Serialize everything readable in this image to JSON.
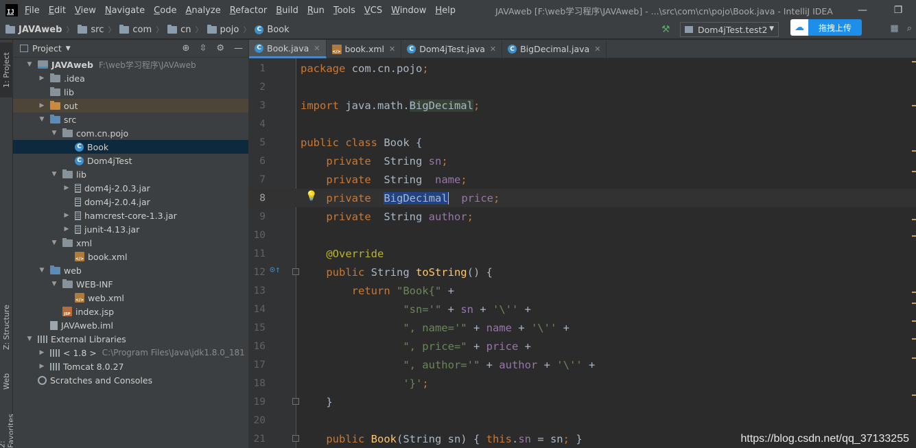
{
  "menubar": {
    "logo": "IJ",
    "items": [
      "File",
      "Edit",
      "View",
      "Navigate",
      "Code",
      "Analyze",
      "Refactor",
      "Build",
      "Run",
      "Tools",
      "VCS",
      "Window",
      "Help"
    ],
    "window_title": "JAVAweb [F:\\web学习程序\\JAVAweb] - ...\\src\\com\\cn\\pojo\\Book.java - IntelliJ IDEA",
    "minimize": "—",
    "restore": "❐"
  },
  "navbar": {
    "breadcrumbs": [
      "JAVAweb",
      "src",
      "com",
      "cn",
      "pojo",
      "Book"
    ],
    "run_config": "Dom4jTest.test2",
    "upload_label": "拖拽上传"
  },
  "left_stripe": {
    "project_tab": "1: Project",
    "structure_tab": "Z: Structure",
    "web_tab": "Web",
    "favorites_tab": "2: Favorites"
  },
  "project_panel": {
    "title": "Project",
    "tree": [
      {
        "label": "JAVAweb",
        "hint": "F:\\web学习程序\\JAVAweb",
        "depth": 0,
        "expanded": true,
        "icon": "module"
      },
      {
        "label": ".idea",
        "depth": 1,
        "expanded": false,
        "icon": "folder"
      },
      {
        "label": "lib",
        "depth": 1,
        "icon": "folder",
        "leaf": true
      },
      {
        "label": "out",
        "depth": 1,
        "expanded": false,
        "icon": "folder-out"
      },
      {
        "label": "src",
        "depth": 1,
        "expanded": true,
        "icon": "folder-src"
      },
      {
        "label": "com.cn.pojo",
        "depth": 2,
        "expanded": true,
        "icon": "folder"
      },
      {
        "label": "Book",
        "depth": 3,
        "icon": "class",
        "leaf": true,
        "selected": true
      },
      {
        "label": "Dom4jTest",
        "depth": 3,
        "icon": "class",
        "leaf": true
      },
      {
        "label": "lib",
        "depth": 2,
        "expanded": true,
        "icon": "folder"
      },
      {
        "label": "dom4j-2.0.3.jar",
        "depth": 3,
        "expanded": false,
        "icon": "jar"
      },
      {
        "label": "dom4j-2.0.4.jar",
        "depth": 3,
        "icon": "jar",
        "leaf": true
      },
      {
        "label": "hamcrest-core-1.3.jar",
        "depth": 3,
        "expanded": false,
        "icon": "jar"
      },
      {
        "label": "junit-4.13.jar",
        "depth": 3,
        "expanded": false,
        "icon": "jar"
      },
      {
        "label": "xml",
        "depth": 2,
        "expanded": true,
        "icon": "folder"
      },
      {
        "label": "book.xml",
        "depth": 3,
        "icon": "xml",
        "leaf": true
      },
      {
        "label": "web",
        "depth": 1,
        "expanded": true,
        "icon": "folder-web"
      },
      {
        "label": "WEB-INF",
        "depth": 2,
        "expanded": true,
        "icon": "folder"
      },
      {
        "label": "web.xml",
        "depth": 3,
        "icon": "xml",
        "leaf": true
      },
      {
        "label": "index.jsp",
        "depth": 2,
        "icon": "jsp",
        "leaf": true
      },
      {
        "label": "JAVAweb.iml",
        "depth": 1,
        "icon": "iml",
        "leaf": true
      },
      {
        "label": "External Libraries",
        "depth": 0,
        "expanded": true,
        "icon": "libs"
      },
      {
        "label": "< 1.8 >",
        "hint": "C:\\Program Files\\Java\\jdk1.8.0_181",
        "depth": 1,
        "expanded": false,
        "icon": "libs"
      },
      {
        "label": "Tomcat 8.0.27",
        "depth": 1,
        "expanded": false,
        "icon": "libs"
      },
      {
        "label": "Scratches and Consoles",
        "depth": 0,
        "icon": "scratch",
        "leaf": true
      }
    ]
  },
  "tabs": [
    {
      "label": "Book.java",
      "icon": "class",
      "active": true
    },
    {
      "label": "book.xml",
      "icon": "xml"
    },
    {
      "label": "Dom4jTest.java",
      "icon": "class"
    },
    {
      "label": "BigDecimal.java",
      "icon": "class"
    }
  ],
  "editor": {
    "current_line": 8,
    "lines": [
      [
        {
          "t": "package ",
          "c": "kw"
        },
        {
          "t": "com.cn.pojo"
        },
        {
          "t": ";",
          "c": "kw"
        }
      ],
      [],
      [
        {
          "t": "import ",
          "c": "kw"
        },
        {
          "t": "java.math."
        },
        {
          "t": "BigDecimal",
          "c": "imp"
        },
        {
          "t": ";",
          "c": "kw"
        }
      ],
      [],
      [
        {
          "t": "public class ",
          "c": "kw"
        },
        {
          "t": "Book {"
        }
      ],
      [
        {
          "t": "    private  ",
          "c": "kw"
        },
        {
          "t": "String "
        },
        {
          "t": "sn",
          "c": "fld"
        },
        {
          "t": ";",
          "c": "kw"
        }
      ],
      [
        {
          "t": "    private  ",
          "c": "kw"
        },
        {
          "t": "String  "
        },
        {
          "t": "name",
          "c": "fld"
        },
        {
          "t": ";",
          "c": "kw"
        }
      ],
      [
        {
          "t": "    private  ",
          "c": "kw"
        },
        {
          "t": "BigDecimal",
          "c": "sel"
        },
        {
          "t": "  "
        },
        {
          "t": "price",
          "c": "fld"
        },
        {
          "t": ";",
          "c": "kw"
        }
      ],
      [
        {
          "t": "    private  ",
          "c": "kw"
        },
        {
          "t": "String "
        },
        {
          "t": "author",
          "c": "fld"
        },
        {
          "t": ";",
          "c": "kw"
        }
      ],
      [],
      [
        {
          "t": "    @Override",
          "c": "ann"
        }
      ],
      [
        {
          "t": "    public ",
          "c": "kw"
        },
        {
          "t": "String "
        },
        {
          "t": "toString",
          "c": "fn"
        },
        {
          "t": "() {"
        }
      ],
      [
        {
          "t": "        return ",
          "c": "kw"
        },
        {
          "t": "\"Book{\"",
          "c": "str"
        },
        {
          "t": " +"
        }
      ],
      [
        {
          "t": "                "
        },
        {
          "t": "\"sn='\"",
          "c": "str"
        },
        {
          "t": " + "
        },
        {
          "t": "sn",
          "c": "fld"
        },
        {
          "t": " + "
        },
        {
          "t": "'\\''",
          "c": "str"
        },
        {
          "t": " +"
        }
      ],
      [
        {
          "t": "                "
        },
        {
          "t": "\", name='\"",
          "c": "str"
        },
        {
          "t": " + "
        },
        {
          "t": "name",
          "c": "fld"
        },
        {
          "t": " + "
        },
        {
          "t": "'\\''",
          "c": "str"
        },
        {
          "t": " +"
        }
      ],
      [
        {
          "t": "                "
        },
        {
          "t": "\", price=\"",
          "c": "str"
        },
        {
          "t": " + "
        },
        {
          "t": "price",
          "c": "fld"
        },
        {
          "t": " +"
        }
      ],
      [
        {
          "t": "                "
        },
        {
          "t": "\", author='\"",
          "c": "str"
        },
        {
          "t": " + "
        },
        {
          "t": "author",
          "c": "fld"
        },
        {
          "t": " + "
        },
        {
          "t": "'\\''",
          "c": "str"
        },
        {
          "t": " +"
        }
      ],
      [
        {
          "t": "                "
        },
        {
          "t": "'}'",
          "c": "str"
        },
        {
          "t": ";",
          "c": "kw"
        }
      ],
      [
        {
          "t": "    }"
        }
      ],
      [],
      [
        {
          "t": "    public ",
          "c": "kw"
        },
        {
          "t": "Book",
          "c": "fn2"
        },
        {
          "t": "(String sn) { "
        },
        {
          "t": "this",
          "c": "kw"
        },
        {
          "t": "."
        },
        {
          "t": "sn",
          "c": "fld"
        },
        {
          "t": " = sn"
        },
        {
          "t": ";",
          "c": "kw"
        },
        {
          "t": " }"
        }
      ]
    ]
  },
  "watermark": "https://blog.csdn.net/qq_37133255",
  "colors": {
    "background": "#2b2b2b",
    "panel": "#3c3f41",
    "keyword": "#cc7832",
    "string": "#6a8759",
    "field": "#9876aa",
    "selection": "#214283"
  }
}
